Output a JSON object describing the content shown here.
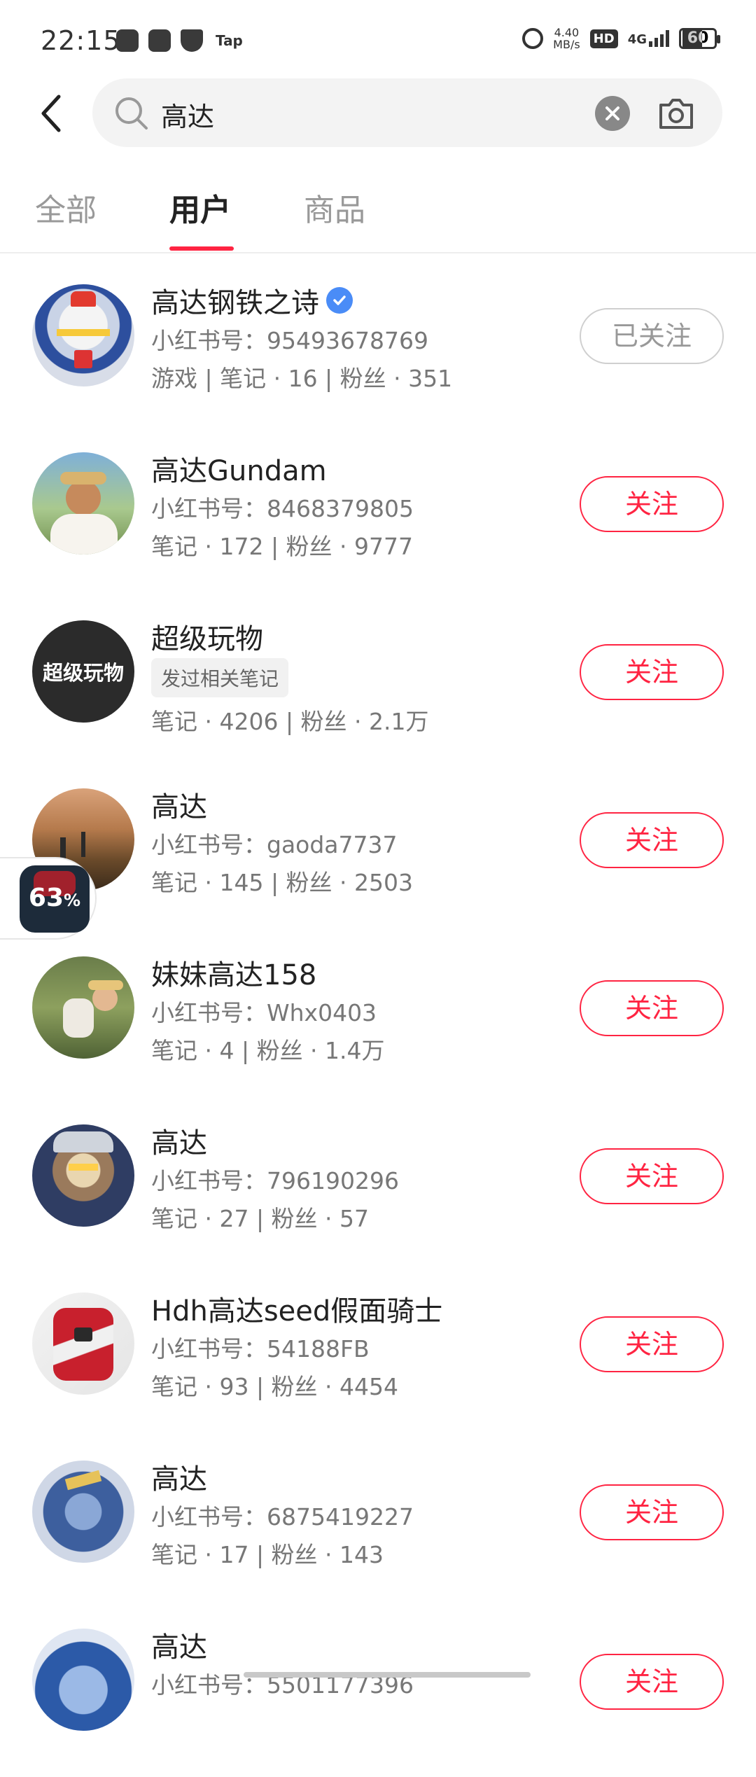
{
  "status_bar": {
    "time": "22:15",
    "net_speed_value": "4.40",
    "net_speed_unit": "MB/s",
    "hd_label": "HD",
    "network_label": "4G",
    "battery_level": "60",
    "app_label": "Tap"
  },
  "search": {
    "query": "高达"
  },
  "tabs": [
    {
      "label": "全部"
    },
    {
      "label": "用户"
    },
    {
      "label": "商品"
    }
  ],
  "active_tab": "用户",
  "users": [
    {
      "name": "高达钢铁之诗",
      "verified": true,
      "id_line": "小红书号：95493678769",
      "stats": "游戏 | 笔记 · 16 | 粉丝 · 351",
      "button": "已关注"
    },
    {
      "name": "高达Gundam",
      "id_line": "小红书号：8468379805",
      "stats": "笔记 · 172 | 粉丝 · 9777",
      "button": "关注"
    },
    {
      "name": "超级玩物",
      "tag": "发过相关笔记",
      "stats": "笔记 · 4206 | 粉丝 · 2.1万",
      "button": "关注",
      "avatar_text": "超级玩物"
    },
    {
      "name": "高达",
      "id_line": "小红书号：gaoda7737",
      "stats": "笔记 · 145 | 粉丝 · 2503",
      "button": "关注"
    },
    {
      "name": "妹妹高达158",
      "id_line": "小红书号：Whx0403",
      "stats": "笔记 · 4 | 粉丝 · 1.4万",
      "button": "关注"
    },
    {
      "name": "高达",
      "id_line": "小红书号：796190296",
      "stats": "笔记 · 27 | 粉丝 · 57",
      "button": "关注"
    },
    {
      "name": "Hdh高达seed假面骑士",
      "id_line": "小红书号：54188FB",
      "stats": "笔记 · 93 | 粉丝 · 4454",
      "button": "关注"
    },
    {
      "name": "高达",
      "id_line": "小红书号：6875419227",
      "stats": "笔记 · 17 | 粉丝 · 143",
      "button": "关注"
    },
    {
      "name": "高达",
      "id_line": "小红书号：5501177396",
      "button": "关注"
    }
  ],
  "floating_widget": {
    "percent": "63",
    "percent_sign": "%"
  },
  "colors": {
    "accent": "#ff2442",
    "verified": "#4a8cf7"
  }
}
